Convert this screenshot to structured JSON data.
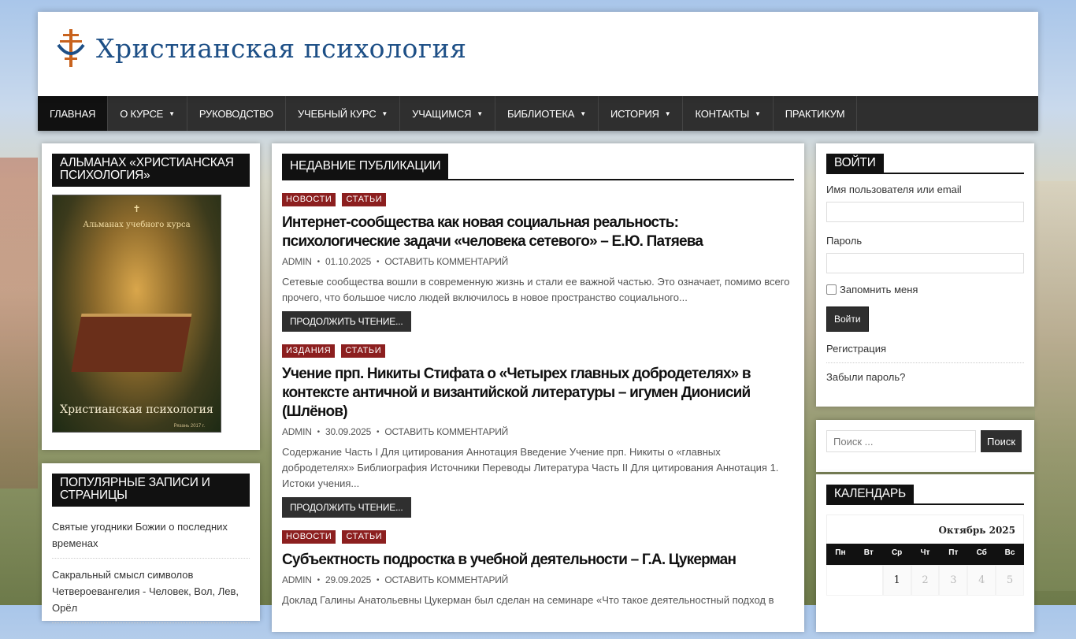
{
  "site": {
    "title": "Христианская психология"
  },
  "nav": [
    {
      "label": "Главная",
      "dropdown": false,
      "active": true
    },
    {
      "label": "О курсе",
      "dropdown": true
    },
    {
      "label": "Руководство",
      "dropdown": false
    },
    {
      "label": "Учебный курс",
      "dropdown": true
    },
    {
      "label": "Учащимся",
      "dropdown": true
    },
    {
      "label": "Библиотека",
      "dropdown": true
    },
    {
      "label": "История",
      "dropdown": true
    },
    {
      "label": "Контакты",
      "dropdown": true
    },
    {
      "label": "Практикум",
      "dropdown": false
    }
  ],
  "left": {
    "almanac_title": "Альманах «Христианская психология»",
    "cover": {
      "top_text": "Альманах учебного курса",
      "title": "Христианская психология",
      "year": "Рязань 2017 г."
    },
    "popular_title": "Популярные записи и страницы",
    "popular": [
      "Святые угодники Божии о последних временах",
      "Сакральный смысл символов Четвероевангелия - Человек, Вол, Лев, Орёл"
    ]
  },
  "center": {
    "section_title": "Недавние публикации",
    "more_label": "Продолжить чтение...",
    "posts": [
      {
        "cats": [
          "Новости",
          "Статьи"
        ],
        "title": "Интернет-сообщества как новая социальная реальность: психологические задачи «человека сетевого» – Е.Ю. Патяева",
        "author": "admin",
        "date": "01.10.2025",
        "comments": "Оставить комментарий",
        "excerpt": "Сетевые сообщества вошли в современную жизнь и стали ее важной частью. Это означает, помимо всего прочего, что большое число людей включилось в новое пространство социального..."
      },
      {
        "cats": [
          "Издания",
          "Статьи"
        ],
        "title": "Учение прп. Никиты Стифата о «Четырех главных добродетелях» в контексте античной и византийской литературы – игумен Дионисий (Шлёнов)",
        "author": "admin",
        "date": "30.09.2025",
        "comments": "Оставить комментарий",
        "excerpt": "Содержание Часть I Для цитирования Аннотация Введение Учение прп. Никиты о «главных добродетелях» Библиография Источники Переводы Литература Часть II Для цитирования Аннотация 1. Истоки учения..."
      },
      {
        "cats": [
          "Новости",
          "Статьи"
        ],
        "title": "Субъектность подростка в учебной деятельности – Г.А. Цукерман",
        "author": "admin",
        "date": "29.09.2025",
        "comments": "Оставить комментарий",
        "excerpt": "Доклад Галины Анатольевны Цукерман был сделан на семинаре «Что такое деятельностный подход в"
      }
    ]
  },
  "login": {
    "title": "Войти",
    "username_label": "Имя пользователя или email",
    "password_label": "Пароль",
    "remember_label": "Запомнить меня",
    "button": "Войти",
    "register": "Регистрация",
    "forgot": "Забыли пароль?"
  },
  "search": {
    "placeholder": "Поиск  ...",
    "button": "Поиск"
  },
  "calendar": {
    "title": "Календарь",
    "month": "Октябрь 2025",
    "days": [
      "Пн",
      "Вт",
      "Ср",
      "Чт",
      "Пт",
      "Сб",
      "Вс"
    ],
    "dates": [
      "1",
      "2",
      "3",
      "4",
      "5"
    ]
  },
  "colors": {
    "nav_bg": "#2f2f2f",
    "category_bg": "#8c1f1f",
    "brand_blue": "#1d4f86"
  }
}
